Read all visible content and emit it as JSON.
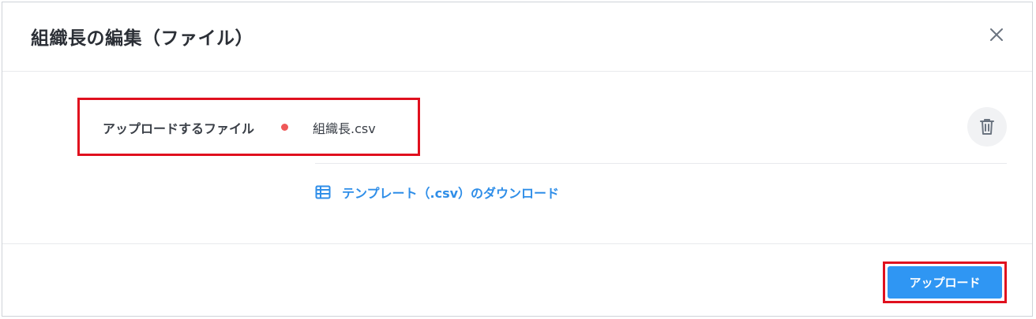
{
  "dialog": {
    "title": "組織長の編集（ファイル）",
    "close_icon": "close-icon"
  },
  "form": {
    "file_label": "アップロードするファイル",
    "file_name": "組織長.csv",
    "required_color": "#ef5858",
    "delete_icon": "trash-icon"
  },
  "template": {
    "icon": "table-icon",
    "link_text": "テンプレート（.csv）のダウンロード",
    "link_color": "#2f8ee8"
  },
  "footer": {
    "upload_label": "アップロード",
    "upload_color": "#2f96f3"
  },
  "annotations": {
    "highlight_color": "#e0101e"
  }
}
